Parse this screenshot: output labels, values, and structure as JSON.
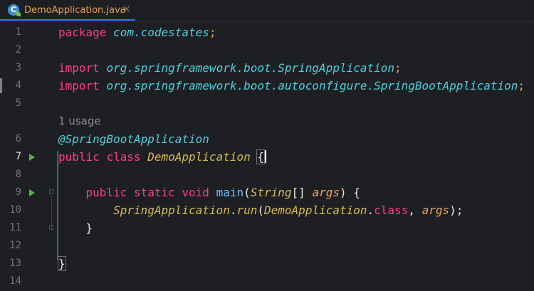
{
  "tab": {
    "icon": "spring-class-icon",
    "icon_letter": "C",
    "filename": "DemoApplication.java",
    "close_glyph": "×"
  },
  "editor": {
    "inlay_hint": "1 usage",
    "lines": [
      {
        "number": "1",
        "parts": [
          {
            "t": "package ",
            "c": "kw2"
          },
          {
            "t": "com.codestates",
            "c": "pkg"
          },
          {
            "t": ";",
            "c": "semi"
          }
        ]
      },
      {
        "number": "2",
        "parts": []
      },
      {
        "number": "3",
        "parts": [
          {
            "t": "import ",
            "c": "kw2"
          },
          {
            "t": "org.springframework.boot.SpringApplication",
            "c": "pkg"
          },
          {
            "t": ";",
            "c": "semi"
          }
        ]
      },
      {
        "number": "4",
        "parts": [
          {
            "t": "import ",
            "c": "kw2"
          },
          {
            "t": "org.springframework.boot.autoconfigure.SpringBootApplication",
            "c": "pkg"
          },
          {
            "t": ";",
            "c": "semi"
          }
        ]
      },
      {
        "number": "5",
        "parts": []
      },
      {
        "number": "6",
        "parts": [
          {
            "t": "@SpringBootApplication",
            "c": "ann"
          }
        ]
      },
      {
        "number": "7",
        "parts": [
          {
            "t": "public ",
            "c": "kw2"
          },
          {
            "t": "class ",
            "c": "kw2"
          },
          {
            "t": "DemoApplication ",
            "c": "cls"
          },
          {
            "t": "{",
            "c": "plain brace-hl"
          }
        ]
      },
      {
        "number": "8",
        "parts": []
      },
      {
        "number": "9",
        "parts": [
          {
            "t": "    public ",
            "c": "kw2"
          },
          {
            "t": "static ",
            "c": "kw2"
          },
          {
            "t": "void ",
            "c": "kw2"
          },
          {
            "t": "main",
            "c": "mth"
          },
          {
            "t": "(",
            "c": "plain"
          },
          {
            "t": "String",
            "c": "cls"
          },
          {
            "t": "[] ",
            "c": "plain"
          },
          {
            "t": "args",
            "c": "param"
          },
          {
            "t": ") {",
            "c": "plain"
          }
        ]
      },
      {
        "number": "10",
        "parts": [
          {
            "t": "        SpringApplication",
            "c": "cls"
          },
          {
            "t": ".",
            "c": "plain"
          },
          {
            "t": "run",
            "c": "cls"
          },
          {
            "t": "(",
            "c": "plain"
          },
          {
            "t": "DemoApplication",
            "c": "cls"
          },
          {
            "t": ".",
            "c": "plain"
          },
          {
            "t": "class",
            "c": "kw2"
          },
          {
            "t": ", ",
            "c": "plain"
          },
          {
            "t": "args",
            "c": "param"
          },
          {
            "t": ");",
            "c": "plain"
          }
        ]
      },
      {
        "number": "11",
        "parts": [
          {
            "t": "    }",
            "c": "plain"
          }
        ]
      },
      {
        "number": "12",
        "parts": []
      },
      {
        "number": "13",
        "parts": [
          {
            "t": "}",
            "c": "plain brace-hl"
          }
        ]
      },
      {
        "number": "14",
        "parts": []
      }
    ],
    "current_line": "7",
    "run_gutter_lines": [
      "7",
      "9"
    ]
  },
  "colors": {
    "background": "#1e1f22",
    "keyword": "#ff3c88",
    "package": "#4cd0e1",
    "class": "#d7bb55",
    "method": "#6ebfff",
    "parameter": "#f0a35c",
    "run_icon": "#58b24f"
  }
}
